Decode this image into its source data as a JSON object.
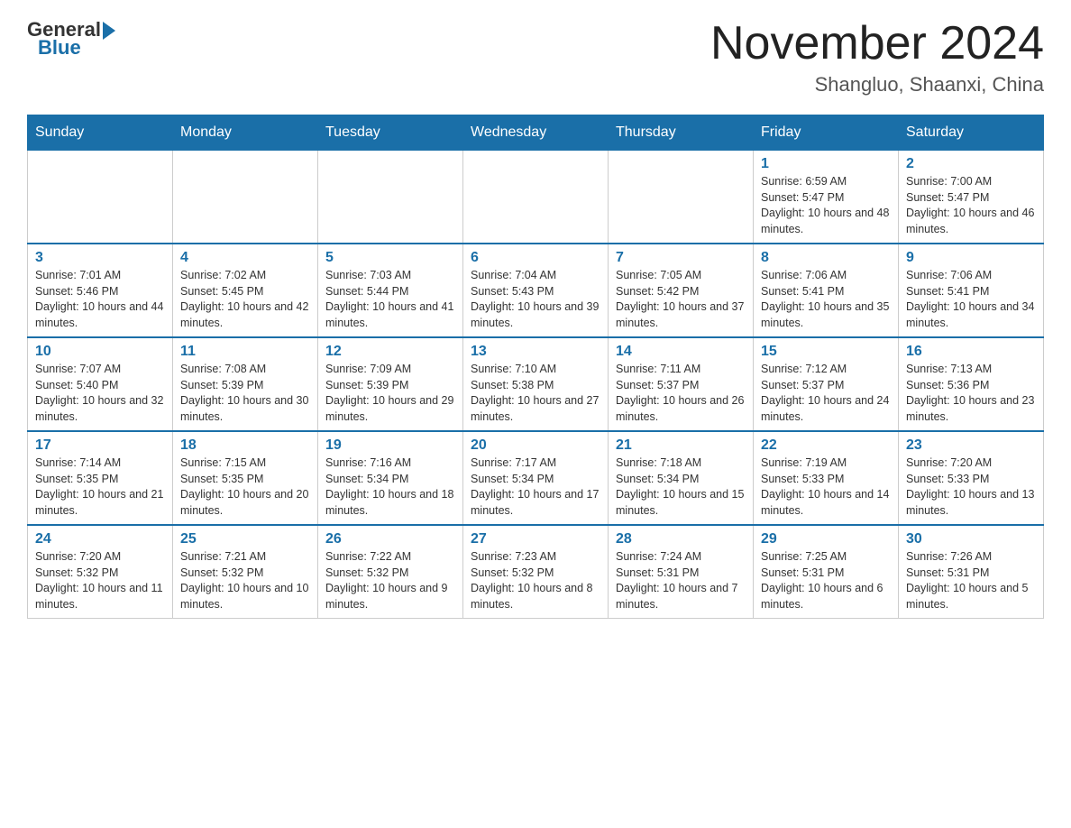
{
  "header": {
    "logo": {
      "general": "General",
      "blue": "Blue"
    },
    "title": "November 2024",
    "location": "Shangluo, Shaanxi, China"
  },
  "days_of_week": [
    "Sunday",
    "Monday",
    "Tuesday",
    "Wednesday",
    "Thursday",
    "Friday",
    "Saturday"
  ],
  "weeks": [
    [
      {
        "day": "",
        "info": ""
      },
      {
        "day": "",
        "info": ""
      },
      {
        "day": "",
        "info": ""
      },
      {
        "day": "",
        "info": ""
      },
      {
        "day": "",
        "info": ""
      },
      {
        "day": "1",
        "info": "Sunrise: 6:59 AM\nSunset: 5:47 PM\nDaylight: 10 hours and 48 minutes."
      },
      {
        "day": "2",
        "info": "Sunrise: 7:00 AM\nSunset: 5:47 PM\nDaylight: 10 hours and 46 minutes."
      }
    ],
    [
      {
        "day": "3",
        "info": "Sunrise: 7:01 AM\nSunset: 5:46 PM\nDaylight: 10 hours and 44 minutes."
      },
      {
        "day": "4",
        "info": "Sunrise: 7:02 AM\nSunset: 5:45 PM\nDaylight: 10 hours and 42 minutes."
      },
      {
        "day": "5",
        "info": "Sunrise: 7:03 AM\nSunset: 5:44 PM\nDaylight: 10 hours and 41 minutes."
      },
      {
        "day": "6",
        "info": "Sunrise: 7:04 AM\nSunset: 5:43 PM\nDaylight: 10 hours and 39 minutes."
      },
      {
        "day": "7",
        "info": "Sunrise: 7:05 AM\nSunset: 5:42 PM\nDaylight: 10 hours and 37 minutes."
      },
      {
        "day": "8",
        "info": "Sunrise: 7:06 AM\nSunset: 5:41 PM\nDaylight: 10 hours and 35 minutes."
      },
      {
        "day": "9",
        "info": "Sunrise: 7:06 AM\nSunset: 5:41 PM\nDaylight: 10 hours and 34 minutes."
      }
    ],
    [
      {
        "day": "10",
        "info": "Sunrise: 7:07 AM\nSunset: 5:40 PM\nDaylight: 10 hours and 32 minutes."
      },
      {
        "day": "11",
        "info": "Sunrise: 7:08 AM\nSunset: 5:39 PM\nDaylight: 10 hours and 30 minutes."
      },
      {
        "day": "12",
        "info": "Sunrise: 7:09 AM\nSunset: 5:39 PM\nDaylight: 10 hours and 29 minutes."
      },
      {
        "day": "13",
        "info": "Sunrise: 7:10 AM\nSunset: 5:38 PM\nDaylight: 10 hours and 27 minutes."
      },
      {
        "day": "14",
        "info": "Sunrise: 7:11 AM\nSunset: 5:37 PM\nDaylight: 10 hours and 26 minutes."
      },
      {
        "day": "15",
        "info": "Sunrise: 7:12 AM\nSunset: 5:37 PM\nDaylight: 10 hours and 24 minutes."
      },
      {
        "day": "16",
        "info": "Sunrise: 7:13 AM\nSunset: 5:36 PM\nDaylight: 10 hours and 23 minutes."
      }
    ],
    [
      {
        "day": "17",
        "info": "Sunrise: 7:14 AM\nSunset: 5:35 PM\nDaylight: 10 hours and 21 minutes."
      },
      {
        "day": "18",
        "info": "Sunrise: 7:15 AM\nSunset: 5:35 PM\nDaylight: 10 hours and 20 minutes."
      },
      {
        "day": "19",
        "info": "Sunrise: 7:16 AM\nSunset: 5:34 PM\nDaylight: 10 hours and 18 minutes."
      },
      {
        "day": "20",
        "info": "Sunrise: 7:17 AM\nSunset: 5:34 PM\nDaylight: 10 hours and 17 minutes."
      },
      {
        "day": "21",
        "info": "Sunrise: 7:18 AM\nSunset: 5:34 PM\nDaylight: 10 hours and 15 minutes."
      },
      {
        "day": "22",
        "info": "Sunrise: 7:19 AM\nSunset: 5:33 PM\nDaylight: 10 hours and 14 minutes."
      },
      {
        "day": "23",
        "info": "Sunrise: 7:20 AM\nSunset: 5:33 PM\nDaylight: 10 hours and 13 minutes."
      }
    ],
    [
      {
        "day": "24",
        "info": "Sunrise: 7:20 AM\nSunset: 5:32 PM\nDaylight: 10 hours and 11 minutes."
      },
      {
        "day": "25",
        "info": "Sunrise: 7:21 AM\nSunset: 5:32 PM\nDaylight: 10 hours and 10 minutes."
      },
      {
        "day": "26",
        "info": "Sunrise: 7:22 AM\nSunset: 5:32 PM\nDaylight: 10 hours and 9 minutes."
      },
      {
        "day": "27",
        "info": "Sunrise: 7:23 AM\nSunset: 5:32 PM\nDaylight: 10 hours and 8 minutes."
      },
      {
        "day": "28",
        "info": "Sunrise: 7:24 AM\nSunset: 5:31 PM\nDaylight: 10 hours and 7 minutes."
      },
      {
        "day": "29",
        "info": "Sunrise: 7:25 AM\nSunset: 5:31 PM\nDaylight: 10 hours and 6 minutes."
      },
      {
        "day": "30",
        "info": "Sunrise: 7:26 AM\nSunset: 5:31 PM\nDaylight: 10 hours and 5 minutes."
      }
    ]
  ]
}
